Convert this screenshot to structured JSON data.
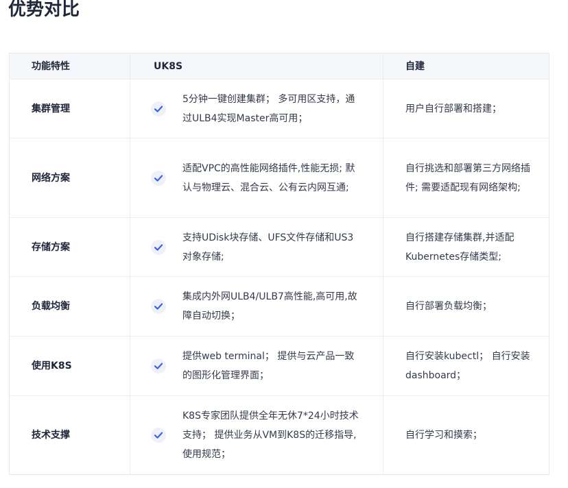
{
  "page": {
    "title": "优势对比"
  },
  "table": {
    "headers": [
      "功能特性",
      "UK8S",
      "自建"
    ],
    "check_color": "#3b63e0",
    "rows": [
      {
        "feature": "集群管理",
        "uk8s": "5分钟一键创建集群； 多可用区支持，通过ULB4实现Master高可用；",
        "self": "用户自行部署和搭建；"
      },
      {
        "feature": "网络方案",
        "uk8s": "适配VPC的高性能网络插件,性能无损; 默认与物理云、混合云、公有云内网互通;",
        "self": "自行挑选和部署第三方网络插件; 需要适配现有网络架构;"
      },
      {
        "feature": "存储方案",
        "uk8s": "支持UDisk块存储、UFS文件存储和US3对象存储;",
        "self": "自行搭建存储集群,并适配Kubernetes存储类型;"
      },
      {
        "feature": "负载均衡",
        "uk8s": "集成内外网ULB4/ULB7高性能,高可用,故障自动切换；",
        "self": "自行部署负载均衡；"
      },
      {
        "feature": "使用K8S",
        "uk8s": "提供web terminal； 提供与云产品一致的图形化管理界面；",
        "self": "自行安装kubectl； 自行安装dashboard；"
      },
      {
        "feature": "技术支撑",
        "uk8s": "K8S专家团队提供全年无休7*24小时技术支持； 提供业务从VM到K8S的迁移指导,使用规范；",
        "self": "自行学习和摸索；"
      }
    ]
  }
}
